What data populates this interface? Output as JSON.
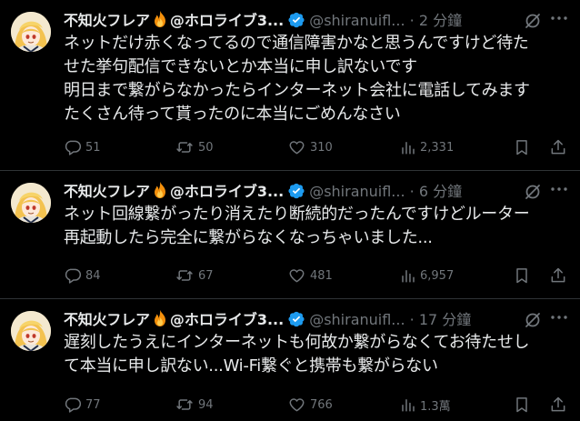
{
  "colors": {
    "background": "#000000",
    "text": "#e7e9ea",
    "muted": "#71767b",
    "divider": "#2f3336",
    "verified": "#1d9bf0"
  },
  "tweets": [
    {
      "display_name": "不知火フレア",
      "handle_name": "@ホロライブ3...",
      "username": "@shiranuifl...",
      "time": "· 2 分鐘",
      "lines": [
        "ネットだけ赤くなってるので通信障害かなと思うんですけど待た",
        "せた挙句配信できないとか本当に申し訳ないです",
        "明日まで繋がらなかったらインターネット会社に電話してみます",
        "たくさん待って貰ったのに本当にごめんなさい"
      ],
      "replies": "51",
      "reposts": "50",
      "likes": "310",
      "views": "2,331"
    },
    {
      "display_name": "不知火フレア",
      "handle_name": "@ホロライブ3...",
      "username": "@shiranuifl...",
      "time": "· 6 分鐘",
      "lines": [
        "ネット回線繋がったり消えたり断続的だったんですけどルーター",
        "再起動したら完全に繋がらなくなっちゃいました..."
      ],
      "replies": "84",
      "reposts": "67",
      "likes": "481",
      "views": "6,957"
    },
    {
      "display_name": "不知火フレア",
      "handle_name": "@ホロライブ3...",
      "username": "@shiranuifl...",
      "time": "· 17 分鐘",
      "lines": [
        "遅刻したうえにインターネットも何故か繋がらなくてお待たせし",
        "て本当に申し訳ない...Wi-Fi繋ぐと携帯も繋がらない"
      ],
      "replies": "77",
      "reposts": "94",
      "likes": "766",
      "views": "1.3萬"
    }
  ],
  "icons": {
    "flame": "fire-emoji",
    "verified": "verified-badge-icon",
    "grok": "grok-icon",
    "more": "more-icon",
    "reply": "reply-icon",
    "repost": "repost-icon",
    "like": "like-icon",
    "views": "views-icon",
    "bookmark": "bookmark-icon",
    "share": "share-icon"
  }
}
